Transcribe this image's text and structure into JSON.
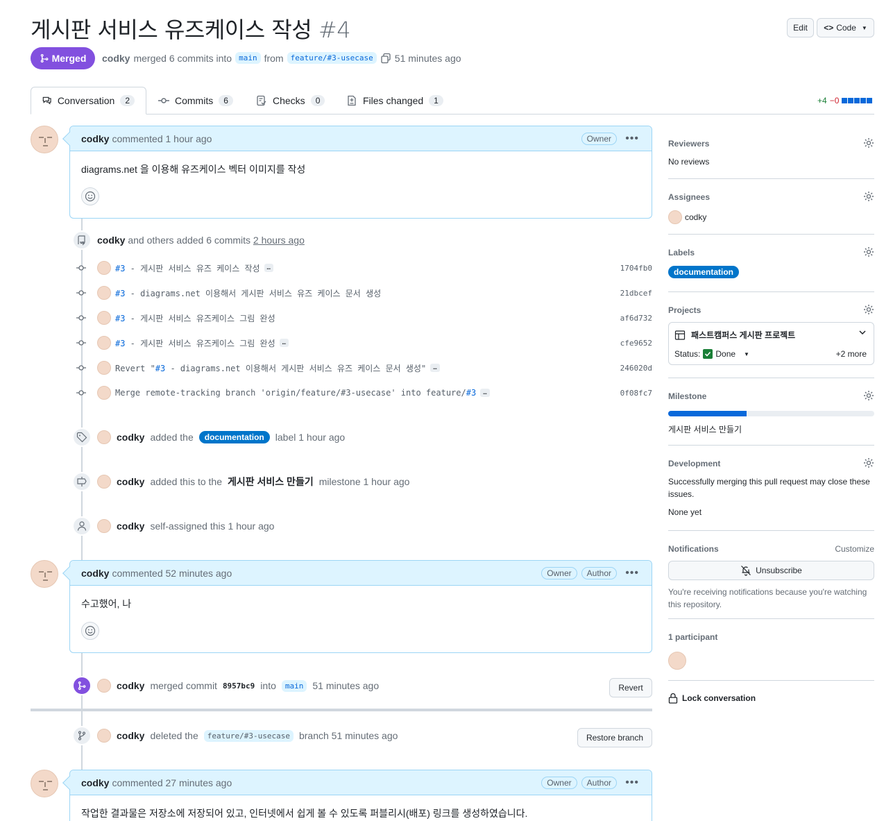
{
  "pr": {
    "title": "게시판 서비스 유즈케이스 작성",
    "number": "#4",
    "state": "Merged",
    "author": "codky",
    "merge_text": "merged 6 commits into",
    "base": "main",
    "from_text": "from",
    "head": "feature/#3-usecase",
    "time": "51 minutes ago"
  },
  "header": {
    "edit": "Edit",
    "code": "Code"
  },
  "tabs": [
    {
      "label": "Conversation",
      "count": "2"
    },
    {
      "label": "Commits",
      "count": "6"
    },
    {
      "label": "Checks",
      "count": "0"
    },
    {
      "label": "Files changed",
      "count": "1"
    }
  ],
  "diffstat": {
    "add": "+4",
    "del": "−0"
  },
  "roles": {
    "owner": "Owner",
    "author": "Author"
  },
  "comments": [
    {
      "author": "codky",
      "meta": "commented 1 hour ago",
      "body": "diagrams.net 을 이용해 유즈케이스 벡터 이미지를 작성"
    },
    {
      "author": "codky",
      "meta": "commented 52 minutes ago",
      "body": "수고했어, 나"
    },
    {
      "author": "codky",
      "meta": "commented 27 minutes ago",
      "body": "작업한 결과물은 저장소에 저장되어 있고, 인터넷에서 쉽게 볼 수 있도록 퍼블리시(배포) 링크를 생성하였습니다."
    }
  ],
  "commits_event": {
    "author": "codky",
    "text": "and others added 6 commits",
    "time": "2 hours ago"
  },
  "commits": [
    {
      "ref": "#3",
      "msg": " - 게시판 서비스 유즈 케이스 작성",
      "more": true,
      "sha": "1704fb0"
    },
    {
      "ref": "#3",
      "msg": " - diagrams.net 이용해서 게시판 서비스 유즈 케이스 문서 생성",
      "more": false,
      "sha": "21dbcef"
    },
    {
      "ref": "#3",
      "msg": " - 게시판 서비스 유즈케이스 그림 완성",
      "more": false,
      "sha": "af6d732"
    },
    {
      "ref": "#3",
      "msg": " - 게시판 서비스 유즈케이스 그림 완성",
      "more": true,
      "sha": "cfe9652"
    },
    {
      "pre": "Revert \"",
      "ref": "#3",
      "msg": " - diagrams.net 이용해서 게시판 서비스 유즈 케이스 문서 생성\"",
      "more": true,
      "sha": "246020d"
    },
    {
      "pre": "Merge remote-tracking branch 'origin/feature/#3-usecase' into feature/",
      "ref": "#3",
      "msg": "",
      "more": true,
      "sha": "0f08fc7"
    }
  ],
  "events": {
    "label": {
      "author": "codky",
      "pre": "added the",
      "label": "documentation",
      "post": "label 1 hour ago"
    },
    "milestone": {
      "author": "codky",
      "pre": "added this to the",
      "name": "게시판 서비스 만들기",
      "post": "milestone 1 hour ago"
    },
    "assign": {
      "author": "codky",
      "text": "self-assigned this 1 hour ago"
    },
    "merged": {
      "author": "codky",
      "pre": "merged commit",
      "sha": "8957bc9",
      "into": "into",
      "base": "main",
      "time": "51 minutes ago",
      "button": "Revert"
    },
    "deleted": {
      "author": "codky",
      "pre": "deleted the",
      "branch": "feature/#3-usecase",
      "post": "branch 51 minutes ago",
      "button": "Restore branch"
    }
  },
  "sidebar": {
    "reviewers": {
      "title": "Reviewers",
      "value": "No reviews"
    },
    "assignees": {
      "title": "Assignees",
      "value": "codky"
    },
    "labels": {
      "title": "Labels",
      "value": "documentation"
    },
    "projects": {
      "title": "Projects",
      "name": "패스트캠퍼스 게시판 프로젝트",
      "status_label": "Status:",
      "status": "Done",
      "more": "+2 more"
    },
    "milestone": {
      "title": "Milestone",
      "name": "게시판 서비스 만들기",
      "progress": 0.38
    },
    "development": {
      "title": "Development",
      "text": "Successfully merging this pull request may close these issues.",
      "none": "None yet"
    },
    "notifications": {
      "title": "Notifications",
      "customize": "Customize",
      "button": "Unsubscribe",
      "text": "You're receiving notifications because you're watching this repository."
    },
    "participants": {
      "title": "1 participant"
    },
    "lock": "Lock conversation"
  },
  "colors": {
    "merged": "#8250df",
    "link": "#0969da",
    "label": "#0075ca",
    "comment_header": "#ddf4ff"
  }
}
